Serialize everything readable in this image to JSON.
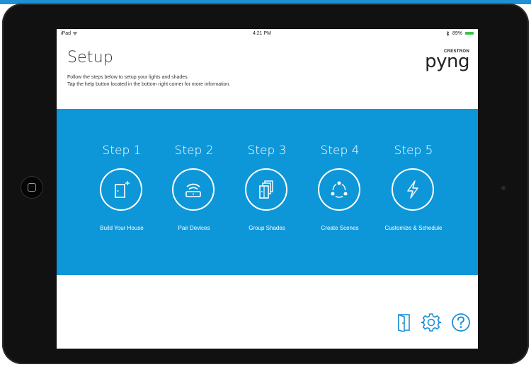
{
  "status_bar": {
    "device": "iPad",
    "time": "4:21 PM",
    "battery": "89%"
  },
  "header": {
    "title": "Setup",
    "instruction_line1": "Follow the steps below to setup your lights and shades.",
    "instruction_line2": "Tap the help button located in the bottom right corner for more information.",
    "logo_top": "CRESTRON",
    "logo_main": "pyng"
  },
  "steps": [
    {
      "title": "Step 1",
      "label": "Build Your House",
      "icon": "door-plus-icon"
    },
    {
      "title": "Step 2",
      "label": "Pair Devices",
      "icon": "wireless-device-icon"
    },
    {
      "title": "Step 3",
      "label": "Group Shades",
      "icon": "stacked-shades-icon"
    },
    {
      "title": "Step 4",
      "label": "Create Scenes",
      "icon": "scene-dots-icon"
    },
    {
      "title": "Step 5",
      "label": "Customize & Schedule",
      "icon": "lightning-icon"
    }
  ],
  "colors": {
    "accent_blue": "#0e97d8",
    "top_strip_blue": "#1f8fd6",
    "battery_green": "#3bc14a"
  },
  "footer": {
    "icons": [
      "exit-door-icon",
      "gear-icon",
      "help-icon"
    ]
  }
}
